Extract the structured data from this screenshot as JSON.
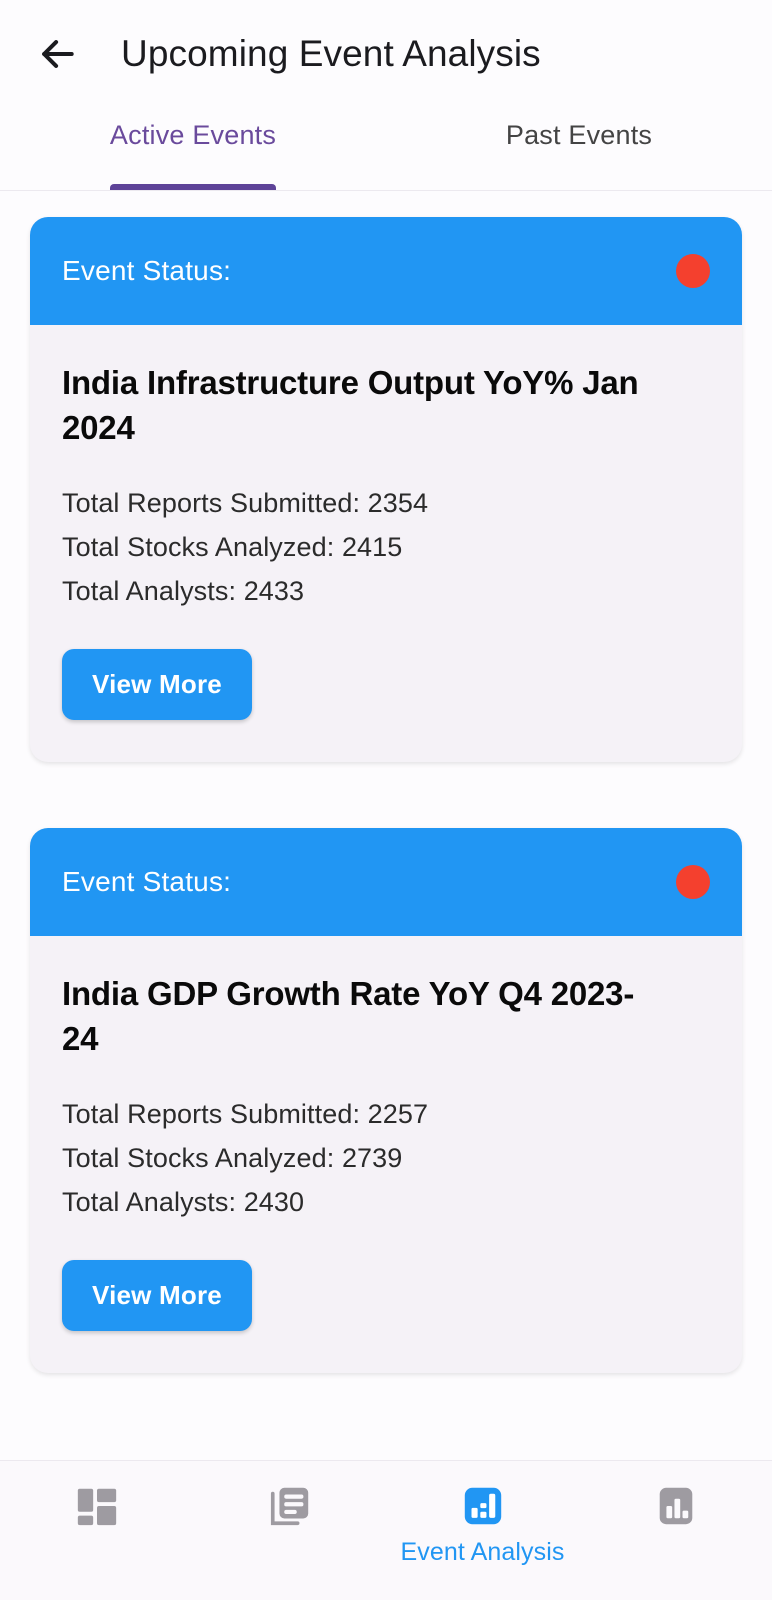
{
  "appbar": {
    "back_icon": "arrow-left-icon",
    "title": "Upcoming Event Analysis"
  },
  "tabs": [
    {
      "label": "Active Events",
      "active": true
    },
    {
      "label": "Past Events",
      "active": false
    }
  ],
  "colors": {
    "accent_blue": "#2196F3",
    "tab_purple": "#5E4398",
    "status_red": "#F4402E",
    "card_bg": "#F5F2F7",
    "page_bg": "#FDFCFE"
  },
  "cards": [
    {
      "header_label": "Event Status:",
      "status_color": "#F4402E",
      "title": "India Infrastructure Output YoY% Jan 2024",
      "stats": [
        "Total Reports Submitted: 2354",
        "Total Stocks Analyzed: 2415",
        "Total Analysts: 2433"
      ],
      "button_label": "View More"
    },
    {
      "header_label": "Event Status:",
      "status_color": "#F4402E",
      "title": "India GDP Growth Rate YoY Q4 2023-24",
      "stats": [
        "Total Reports Submitted: 2257",
        "Total Stocks Analyzed: 2739",
        "Total Analysts: 2430"
      ],
      "button_label": "View More"
    }
  ],
  "bottom_nav": [
    {
      "icon": "dashboard-grid-icon",
      "label": "",
      "active": false
    },
    {
      "icon": "articles-library-icon",
      "label": "",
      "active": false
    },
    {
      "icon": "event-analysis-bar-chart-icon",
      "label": "Event Analysis",
      "active": true
    },
    {
      "icon": "bar-chart-icon",
      "label": "",
      "active": false
    }
  ]
}
